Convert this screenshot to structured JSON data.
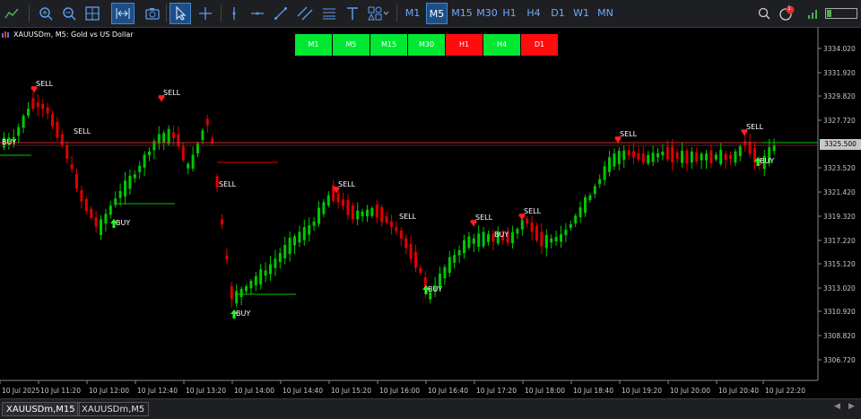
{
  "toolbar": {
    "timeframes": [
      "M1",
      "M5",
      "M15",
      "M30",
      "H1",
      "H4",
      "D1",
      "W1",
      "MN"
    ],
    "active_timeframe": "M5",
    "notification_count": "1"
  },
  "chart": {
    "symbol_title": "XAUUSDm, M5:  Gold vs US Dollar",
    "current_price": "3325.500",
    "tf_panel": [
      {
        "label": "M1",
        "color": "#00e832"
      },
      {
        "label": "M5",
        "color": "#00e832"
      },
      {
        "label": "M15",
        "color": "#00e832"
      },
      {
        "label": "M30",
        "color": "#00e832"
      },
      {
        "label": "H1",
        "color": "#ff0d0d"
      },
      {
        "label": "H4",
        "color": "#00e832"
      },
      {
        "label": "D1",
        "color": "#ff0d0d"
      }
    ],
    "price_axis_labels": [
      "3334.020",
      "3331.920",
      "3329.820",
      "3327.720",
      "3325.500",
      "3323.520",
      "3321.420",
      "3319.320",
      "3317.220",
      "3315.120",
      "3313.020",
      "3310.920",
      "3308.820",
      "3306.720"
    ],
    "time_axis_labels": [
      "10 Jul 2025",
      "10 Jul 11:20",
      "10 Jul 12:00",
      "10 Jul 12:40",
      "10 Jul 13:20",
      "10 Jul 14:00",
      "10 Jul 14:40",
      "10 Jul 15:20",
      "10 Jul 16:00",
      "10 Jul 16:40",
      "10 Jul 17:20",
      "10 Jul 18:00",
      "10 Jul 18:40",
      "10 Jul 19:20",
      "10 Jul 20:00",
      "10 Jul 20:40",
      "10 Jul 22:20"
    ],
    "signals": [
      {
        "type": "SELL",
        "label": "SELL"
      },
      {
        "type": "SELL",
        "label": "SELL"
      },
      {
        "type": "SELL",
        "label": "SELL"
      },
      {
        "type": "SELL",
        "label": "SELL"
      },
      {
        "type": "SELL",
        "label": "SELL"
      },
      {
        "type": "SELL",
        "label": "SELL"
      },
      {
        "type": "SELL",
        "label": "SELL"
      },
      {
        "type": "SELL",
        "label": "SELL"
      },
      {
        "type": "SELL",
        "label": "SELL"
      },
      {
        "type": "SELL",
        "label": "SELL"
      },
      {
        "type": "BUY",
        "label": "BUY"
      },
      {
        "type": "BUY",
        "label": "BUY"
      },
      {
        "type": "BUY",
        "label": "BUY"
      },
      {
        "type": "BUY",
        "label": "BUY"
      },
      {
        "type": "BUY",
        "label": "BUY"
      },
      {
        "type": "BUY",
        "label": "BUY"
      }
    ],
    "colors": {
      "bull": "#00c800",
      "bear": "#e00000",
      "buy": "#22ff22",
      "sell": "#ff2020",
      "grid_text": "#c8c8c8"
    }
  },
  "bottom_tabs": [
    {
      "label": "XAUUSDm,M15"
    },
    {
      "label": "XAUUSDm,M5"
    }
  ]
}
